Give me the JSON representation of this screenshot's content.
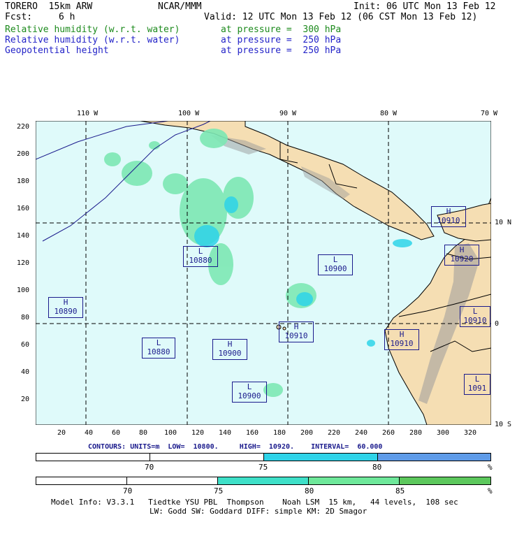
{
  "header": {
    "model": "TORERO  15km ARW",
    "org": "NCAR/MMM",
    "init": "Init: 06 UTC Mon 13 Feb 12",
    "fcst_label": "Fcst:",
    "fcst_value": "6 h",
    "valid": "Valid: 12 UTC Mon 13 Feb 12 (06 CST Mon 13 Feb 12)",
    "fields": [
      {
        "name": "Relative humidity (w.r.t. water)",
        "level": "at pressure =  300 hPa",
        "color": "#1c8a1c"
      },
      {
        "name": "Relative humidity (w.r.t. water)",
        "level": "at pressure =  250 hPa",
        "color": "#2323c8"
      },
      {
        "name": "Geopotential height",
        "level": "at pressure =  250 hPa",
        "color": "#2323c8"
      }
    ]
  },
  "map": {
    "lon_labels": [
      "110 W",
      "100 W",
      "90 W",
      "80 W",
      "70 W"
    ],
    "lat_labels": [
      "10 N",
      "0",
      "10 S"
    ],
    "y_ticks": [
      "220",
      "200",
      "180",
      "160",
      "140",
      "120",
      "100",
      "80",
      "60",
      "40",
      "20"
    ],
    "x_ticks": [
      "20",
      "40",
      "60",
      "80",
      "100",
      "120",
      "140",
      "160",
      "180",
      "200",
      "220",
      "240",
      "260",
      "280",
      "300",
      "320"
    ],
    "ocean_color": "#dffafa",
    "land_color": "#f5deb3",
    "centers": [
      {
        "type": "H",
        "value": "10890"
      },
      {
        "type": "L",
        "value": "10880"
      },
      {
        "type": "L",
        "value": "10880"
      },
      {
        "type": "H",
        "value": "10900"
      },
      {
        "type": "L",
        "value": "10900"
      },
      {
        "type": "H",
        "value": "10910"
      },
      {
        "type": "L",
        "value": "10900"
      },
      {
        "type": "H",
        "value": "10910"
      },
      {
        "type": "H",
        "value": "10910"
      },
      {
        "type": "H",
        "value": "10920"
      },
      {
        "type": "L",
        "value": "10910"
      },
      {
        "type": "L",
        "value": "1091"
      }
    ]
  },
  "contours": {
    "text": "CONTOURS: UNITS=m  LOW=  10800.     HIGH=  10920.    INTERVAL=  60.000"
  },
  "colorbar_250": {
    "labels": [
      "70",
      "75",
      "80",
      "%"
    ],
    "colors": [
      "#ffffff",
      "#ffffff",
      "#2ed3e8",
      "#5e9be8"
    ]
  },
  "colorbar_300": {
    "labels": [
      "70",
      "75",
      "80",
      "85",
      "%"
    ],
    "colors": [
      "#ffffff",
      "#ffffff",
      "#3ee0c8",
      "#6ee89a",
      "#5cc85c"
    ]
  },
  "footer": {
    "line1": "Model Info: V3.3.1   Tiedtke YSU PBL  Thompson    Noah LSM  15 km,   44 levels,  108 sec",
    "line2": "LW: Godd SW: Goddard DIFF: simple KM: 2D Smagor"
  }
}
